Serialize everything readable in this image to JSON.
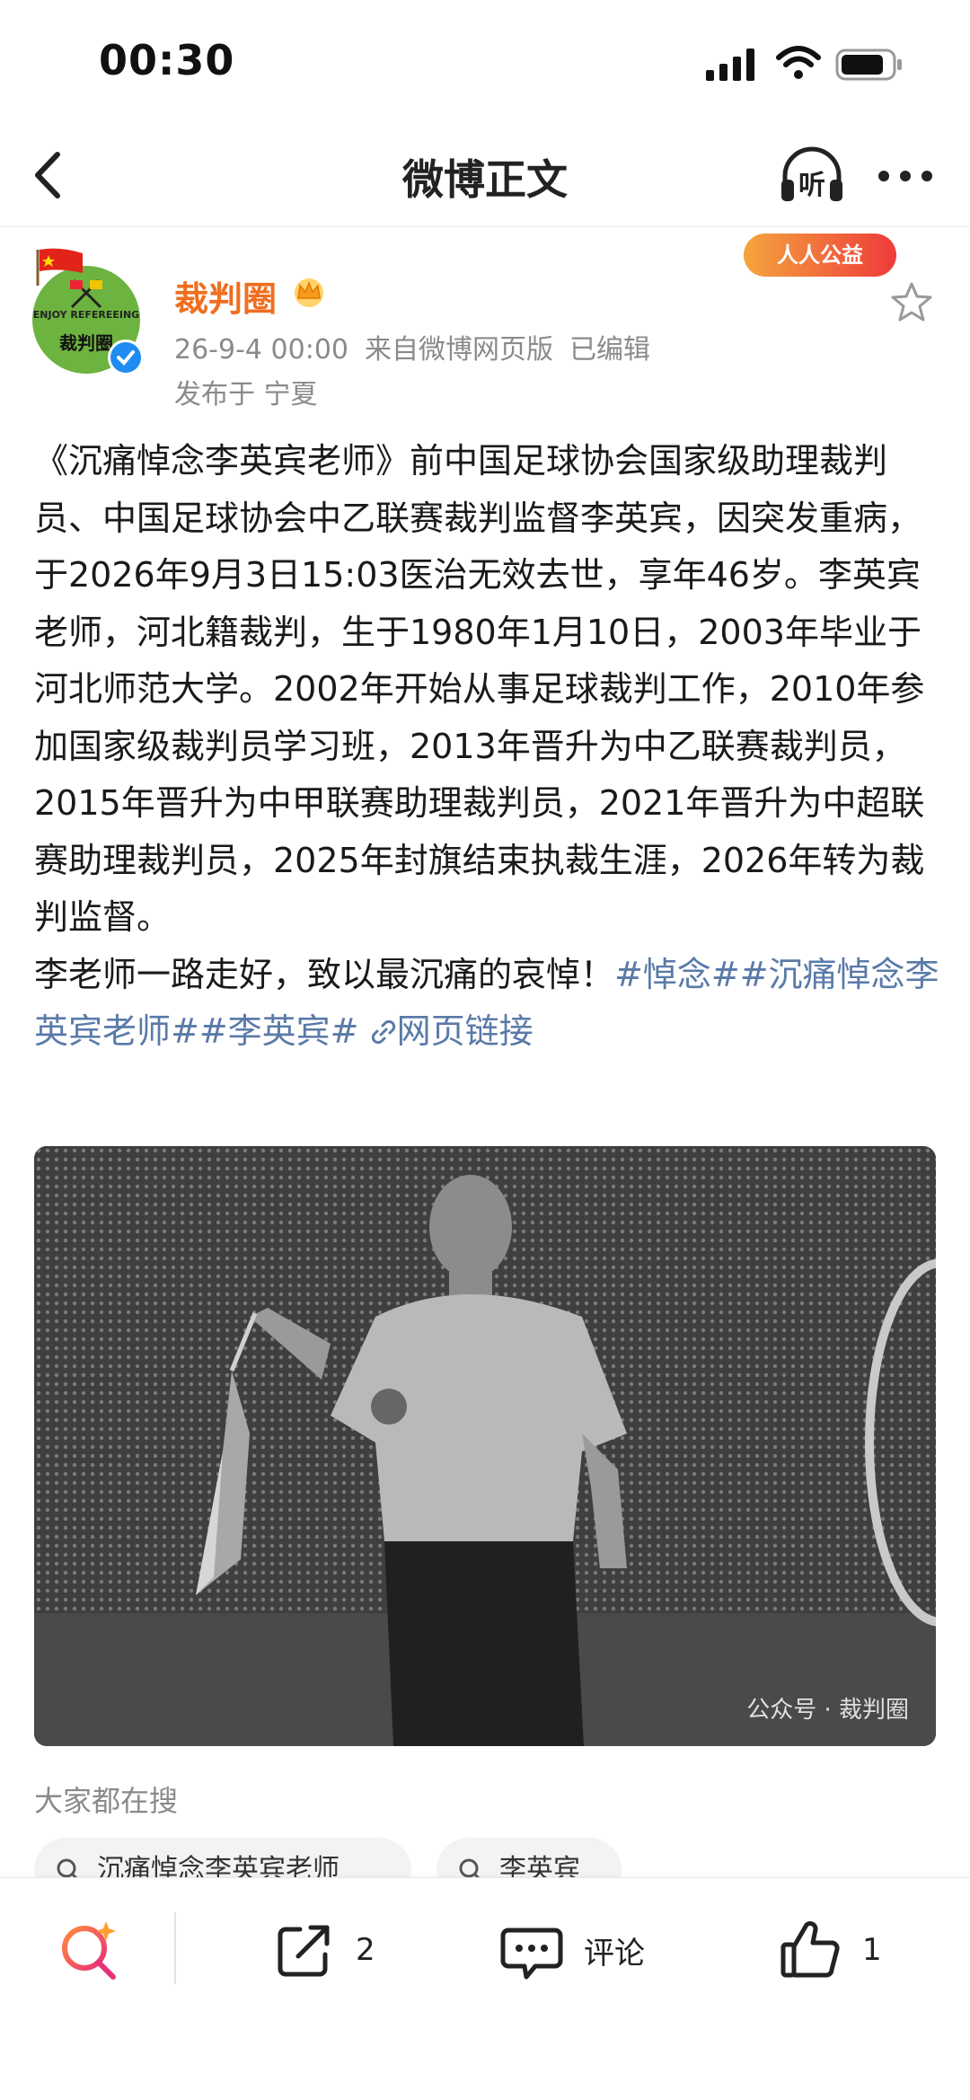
{
  "status_bar": {
    "time": "00:30"
  },
  "nav": {
    "title": "微博正文"
  },
  "post": {
    "username": "裁判圈",
    "timestamp": "26-9-4 00:00",
    "source": "来自微博网页版",
    "edited": "已编辑",
    "location": "发布于 宁夏",
    "charity_badge": "人人公益",
    "avatar_text_top": "ENJOY REFEREEING",
    "avatar_text_main": "裁判圈",
    "paragraph_1": "《沉痛悼念李英宾老师》前中国足球协会国家级助理裁判员、中国足球协会中乙联赛裁判监督李英宾，因突发重病，于2026年9月3日15:03医治无效去世，享年46岁。李英宾老师，河北籍裁判，生于1980年1月10日，2003年毕业于河北师范大学。2002年开始从事足球裁判工作，2010年参加国家级裁判员学习班，2013年晋升为中乙联赛裁判员，2015年晋升为中甲联赛助理裁判员，2021年晋升为中超联赛助理裁判员，2025年封旗结束执裁生涯，2026年转为裁判监督。",
    "paragraph_2_text": "李老师一路走好，致以最沉痛的哀悼！",
    "topic_1": "#悼念#",
    "topic_2": "#沉痛悼念李英宾老师#",
    "topic_3": "#李英宾#",
    "web_link": "网页链接",
    "image_watermark": "公众号 · 裁判圈"
  },
  "search": {
    "label": "大家都在搜",
    "chips": [
      "沉痛悼念李英宾老师",
      "李英宾"
    ]
  },
  "bottom_bar": {
    "repost_count": "2",
    "comment_label": "评论",
    "like_count": "1"
  },
  "colors": {
    "username": "#f06e1f",
    "link": "#5a7aa8",
    "meta": "#8a8a8a",
    "verified": "#1e8cf0"
  },
  "icons": [
    "signal-icon",
    "wifi-icon",
    "battery-icon",
    "back-icon",
    "listen-icon",
    "more-icon",
    "crown-icon",
    "star-icon",
    "link-icon",
    "search-spark-icon",
    "repost-icon",
    "comment-icon",
    "like-icon"
  ]
}
